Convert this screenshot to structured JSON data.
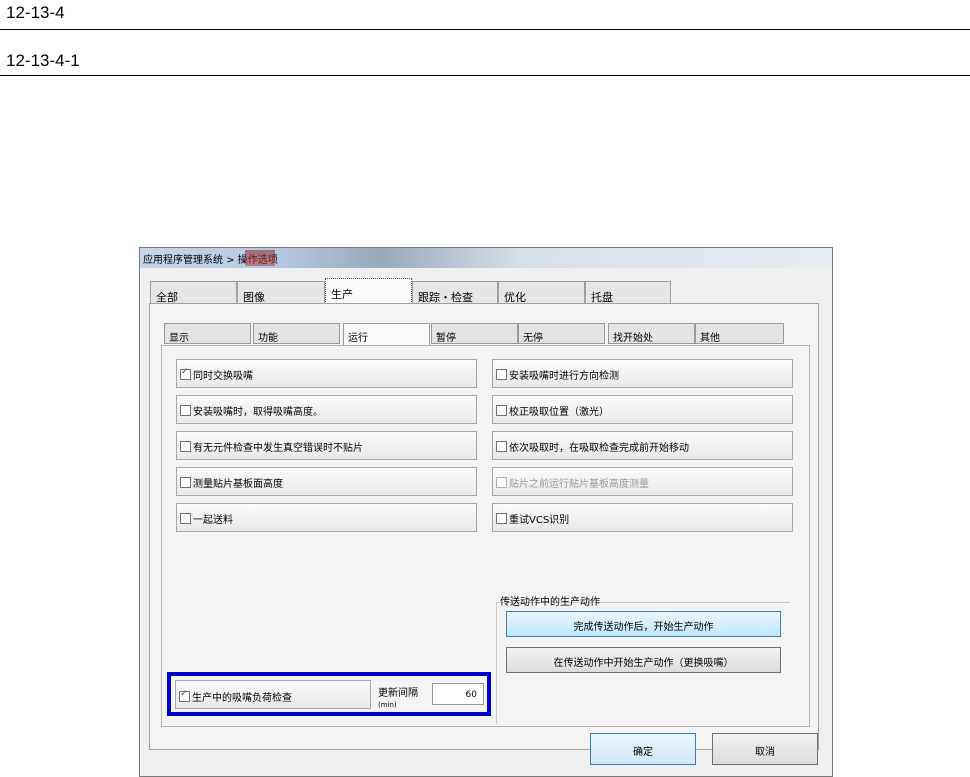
{
  "document": {
    "heading1": "12-13-4",
    "heading2": "12-13-4-1"
  },
  "dialog": {
    "title": "应用程序管理系统 > 操作选项",
    "tabs": [
      "全部",
      "图像",
      "生产",
      "跟踪・检查",
      "优化",
      "托盘"
    ],
    "active_tab": "生产",
    "subtabs": [
      "显示",
      "功能",
      "运行",
      "暂停",
      "无停",
      "找开始处",
      "其他"
    ],
    "active_subtab": "运行",
    "options_left": [
      {
        "label": "同时交换吸嘴",
        "checked": true,
        "enabled": true
      },
      {
        "label": "安装吸嘴时，取得吸嘴高度。",
        "checked": false,
        "enabled": true
      },
      {
        "label": "有无元件检查中发生真空错误时不贴片",
        "checked": false,
        "enabled": true
      },
      {
        "label": "测量贴片基板面高度",
        "checked": false,
        "enabled": true
      },
      {
        "label": "一起送料",
        "checked": false,
        "enabled": true
      }
    ],
    "options_right": [
      {
        "label": "安装吸嘴时进行方向检测",
        "checked": false,
        "enabled": true
      },
      {
        "label": "校正吸取位置（激光）",
        "checked": false,
        "enabled": true
      },
      {
        "label": "依次吸取时，在吸取检查完成前开始移动",
        "checked": false,
        "enabled": true
      },
      {
        "label": "贴片之前运行贴片基板高度测量",
        "checked": false,
        "enabled": false
      },
      {
        "label": "重试VCS识别",
        "checked": false,
        "enabled": true
      }
    ],
    "transfer_group": {
      "label": "传送动作中的生产动作",
      "btn_after": "完成传送动作后，开始生产动作",
      "btn_during": "在传送动作中开始生产动作（更换吸嘴）"
    },
    "nozzle_check": {
      "label": "生产中的吸嘴负荷检查",
      "checked": true,
      "interval_label": "更新间隔",
      "interval_unit": "(min)",
      "interval_value": "60"
    },
    "buttons": {
      "ok": "确定",
      "cancel": "取消"
    },
    "colors": {
      "highlight": "#0000cc",
      "primary_border": "#3c7fb1"
    }
  }
}
